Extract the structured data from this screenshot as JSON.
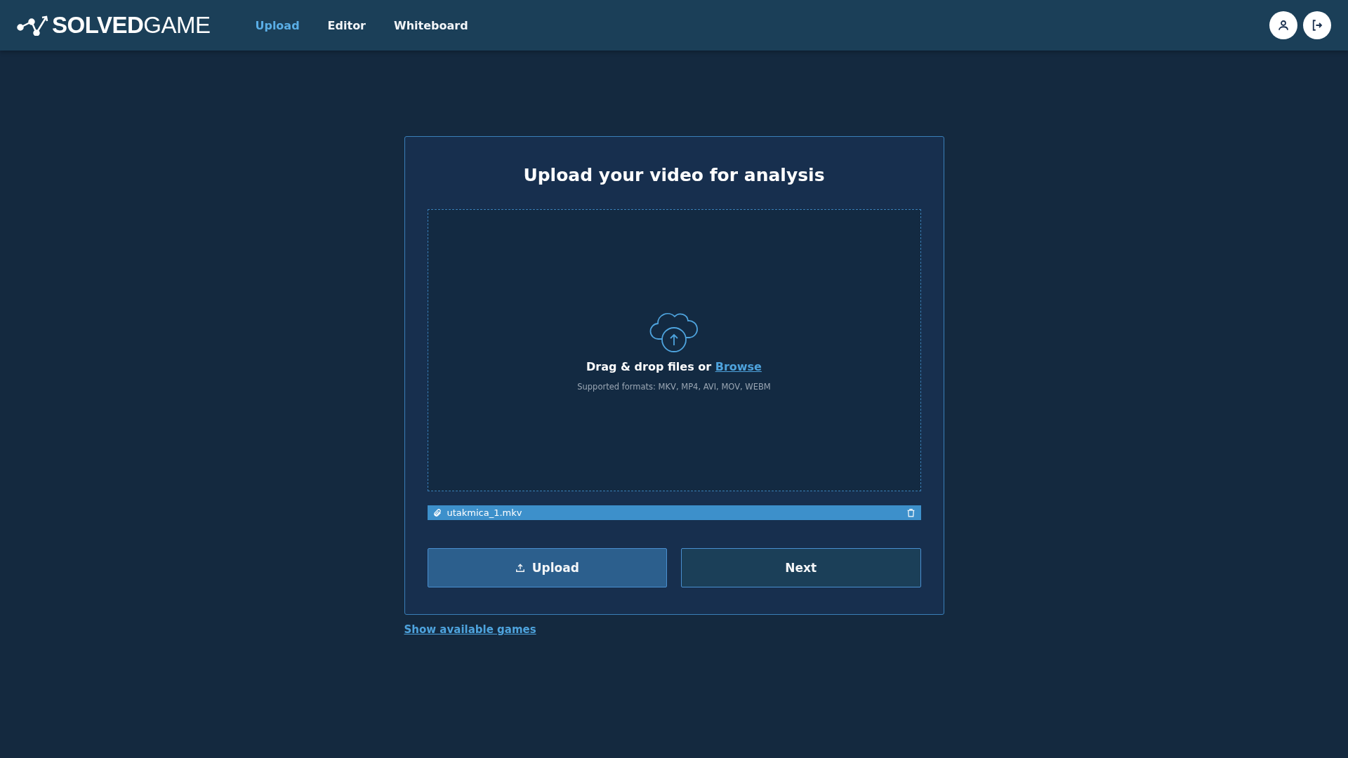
{
  "header": {
    "logo": "**SOLVED**GAME",
    "nav": [
      {
        "label": "Upload",
        "selected": true
      },
      {
        "label": "Editor",
        "selected": false
      },
      {
        "label": "Whiteboard",
        "selected": false
      }
    ]
  },
  "card": {
    "title": "Upload your video for analysis",
    "dropzone": {
      "prompt": "Drag & drop files or",
      "link": "Browse",
      "formats": "Supported formats: MKV, MP4, AVI, MOV, WEBM"
    },
    "files": [
      {
        "name": "utakmica_1.mkv"
      }
    ],
    "buttons": [
      {
        "kind": "upload",
        "label": "Upload"
      },
      {
        "kind": "next",
        "label": "Next"
      }
    ]
  },
  "footer_link": "Show available games"
}
